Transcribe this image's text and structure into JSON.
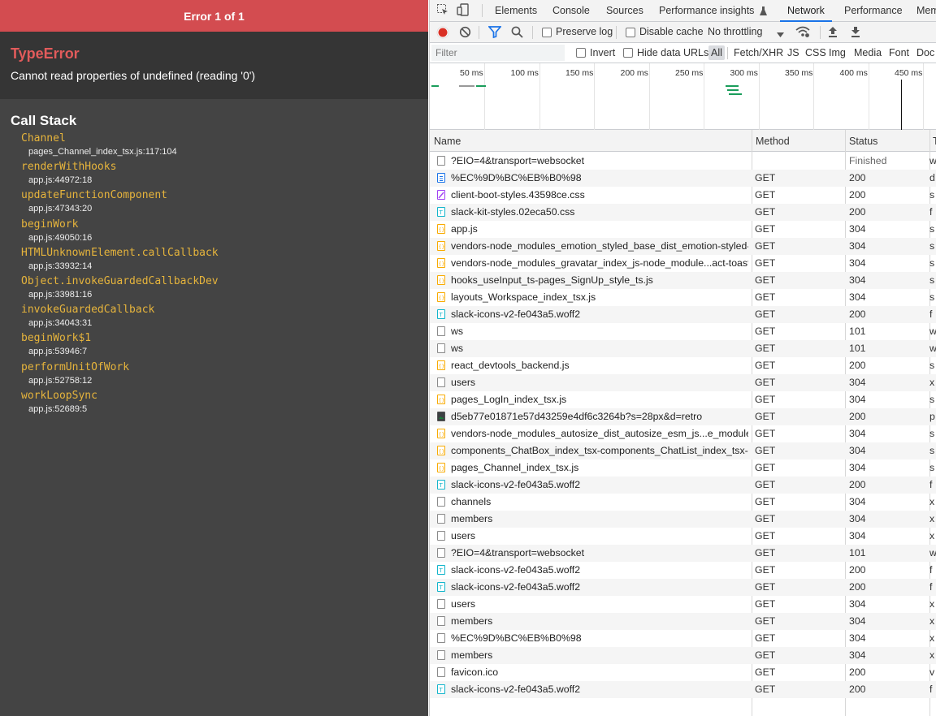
{
  "error_overlay": {
    "header": "Error 1 of 1",
    "error_type": "TypeError",
    "message": "Cannot read properties of undefined (reading '0')",
    "stack_title": "Call Stack",
    "frames": [
      {
        "fn": "Channel",
        "loc": "pages_Channel_index_tsx.js:117:104"
      },
      {
        "fn": "renderWithHooks",
        "loc": "app.js:44972:18"
      },
      {
        "fn": "updateFunctionComponent",
        "loc": "app.js:47343:20"
      },
      {
        "fn": "beginWork",
        "loc": "app.js:49050:16"
      },
      {
        "fn": "HTMLUnknownElement.callCallback",
        "loc": "app.js:33932:14"
      },
      {
        "fn": "Object.invokeGuardedCallbackDev",
        "loc": "app.js:33981:16"
      },
      {
        "fn": "invokeGuardedCallback",
        "loc": "app.js:34043:31"
      },
      {
        "fn": "beginWork$1",
        "loc": "app.js:53946:7"
      },
      {
        "fn": "performUnitOfWork",
        "loc": "app.js:52758:12"
      },
      {
        "fn": "workLoopSync",
        "loc": "app.js:52689:5"
      }
    ]
  },
  "devtools": {
    "tabs": [
      "Elements",
      "Console",
      "Sources",
      "Performance insights",
      "Network",
      "Performance",
      "Mem"
    ],
    "active_tab": "Network",
    "toolbar": {
      "preserve_log": "Preserve log",
      "disable_cache": "Disable cache",
      "throttling": "No throttling"
    },
    "filter": {
      "placeholder": "Filter",
      "invert": "Invert",
      "hide_data_urls": "Hide data URLs",
      "types": [
        "All",
        "Fetch/XHR",
        "JS",
        "CSS",
        "Img",
        "Media",
        "Font",
        "Doc"
      ],
      "selected_type": "All"
    },
    "timeline_ticks": [
      "50 ms",
      "100 ms",
      "150 ms",
      "200 ms",
      "250 ms",
      "300 ms",
      "350 ms",
      "400 ms",
      "450 ms"
    ],
    "columns": {
      "name": "Name",
      "method": "Method",
      "status": "Status",
      "type": "T"
    },
    "rows": [
      {
        "name": "?EIO=4&transport=websocket",
        "method": "",
        "status": "Finished",
        "type": "w",
        "icon": "blank"
      },
      {
        "name": "%EC%9D%BC%EB%B0%98",
        "method": "GET",
        "status": "200",
        "type": "d",
        "icon": "doc"
      },
      {
        "name": "client-boot-styles.43598ce.css",
        "method": "GET",
        "status": "200",
        "type": "s",
        "icon": "css"
      },
      {
        "name": "slack-kit-styles.02eca50.css",
        "method": "GET",
        "status": "200",
        "type": "f",
        "icon": "font"
      },
      {
        "name": "app.js",
        "method": "GET",
        "status": "304",
        "type": "s",
        "icon": "js"
      },
      {
        "name": "vendors-node_modules_emotion_styled_base_dist_emotion-styled-...",
        "method": "GET",
        "status": "304",
        "type": "s",
        "icon": "js"
      },
      {
        "name": "vendors-node_modules_gravatar_index_js-node_module...act-toasti...",
        "method": "GET",
        "status": "304",
        "type": "s",
        "icon": "js"
      },
      {
        "name": "hooks_useInput_ts-pages_SignUp_style_ts.js",
        "method": "GET",
        "status": "304",
        "type": "s",
        "icon": "js"
      },
      {
        "name": "layouts_Workspace_index_tsx.js",
        "method": "GET",
        "status": "304",
        "type": "s",
        "icon": "js"
      },
      {
        "name": "slack-icons-v2-fe043a5.woff2",
        "method": "GET",
        "status": "200",
        "type": "f",
        "icon": "font"
      },
      {
        "name": "ws",
        "method": "GET",
        "status": "101",
        "type": "w",
        "icon": "blank"
      },
      {
        "name": "ws",
        "method": "GET",
        "status": "101",
        "type": "w",
        "icon": "blank"
      },
      {
        "name": "react_devtools_backend.js",
        "method": "GET",
        "status": "200",
        "type": "s",
        "icon": "js"
      },
      {
        "name": "users",
        "method": "GET",
        "status": "304",
        "type": "x",
        "icon": "blank"
      },
      {
        "name": "pages_LogIn_index_tsx.js",
        "method": "GET",
        "status": "304",
        "type": "s",
        "icon": "js"
      },
      {
        "name": "d5eb77e01871e57d43259e4df6c3264b?s=28px&d=retro",
        "method": "GET",
        "status": "200",
        "type": "p",
        "icon": "img"
      },
      {
        "name": "vendors-node_modules_autosize_dist_autosize_esm_js...e_modules_...",
        "method": "GET",
        "status": "304",
        "type": "s",
        "icon": "js"
      },
      {
        "name": "components_ChatBox_index_tsx-components_ChatList_index_tsx-ut...",
        "method": "GET",
        "status": "304",
        "type": "s",
        "icon": "js"
      },
      {
        "name": "pages_Channel_index_tsx.js",
        "method": "GET",
        "status": "304",
        "type": "s",
        "icon": "js"
      },
      {
        "name": "slack-icons-v2-fe043a5.woff2",
        "method": "GET",
        "status": "200",
        "type": "f",
        "icon": "font"
      },
      {
        "name": "channels",
        "method": "GET",
        "status": "304",
        "type": "x",
        "icon": "blank"
      },
      {
        "name": "members",
        "method": "GET",
        "status": "304",
        "type": "x",
        "icon": "blank"
      },
      {
        "name": "users",
        "method": "GET",
        "status": "304",
        "type": "x",
        "icon": "blank"
      },
      {
        "name": "?EIO=4&transport=websocket",
        "method": "GET",
        "status": "101",
        "type": "w",
        "icon": "blank"
      },
      {
        "name": "slack-icons-v2-fe043a5.woff2",
        "method": "GET",
        "status": "200",
        "type": "f",
        "icon": "font"
      },
      {
        "name": "slack-icons-v2-fe043a5.woff2",
        "method": "GET",
        "status": "200",
        "type": "f",
        "icon": "font"
      },
      {
        "name": "users",
        "method": "GET",
        "status": "304",
        "type": "x",
        "icon": "blank"
      },
      {
        "name": "members",
        "method": "GET",
        "status": "304",
        "type": "x",
        "icon": "blank"
      },
      {
        "name": "%EC%9D%BC%EB%B0%98",
        "method": "GET",
        "status": "304",
        "type": "x",
        "icon": "blank"
      },
      {
        "name": "members",
        "method": "GET",
        "status": "304",
        "type": "x",
        "icon": "blank"
      },
      {
        "name": "favicon.ico",
        "method": "GET",
        "status": "200",
        "type": "v",
        "icon": "blank"
      },
      {
        "name": "slack-icons-v2-fe043a5.woff2",
        "method": "GET",
        "status": "200",
        "type": "f",
        "icon": "font"
      }
    ],
    "icon_colors": {
      "blank": "#8a8a8a",
      "doc": "#1a73e8",
      "css": "#a142f4",
      "font": "#12b5cb",
      "js": "#f9ab00",
      "img": "#188038"
    },
    "record_color": "#d93025",
    "accent_color": "#1a73e8"
  }
}
